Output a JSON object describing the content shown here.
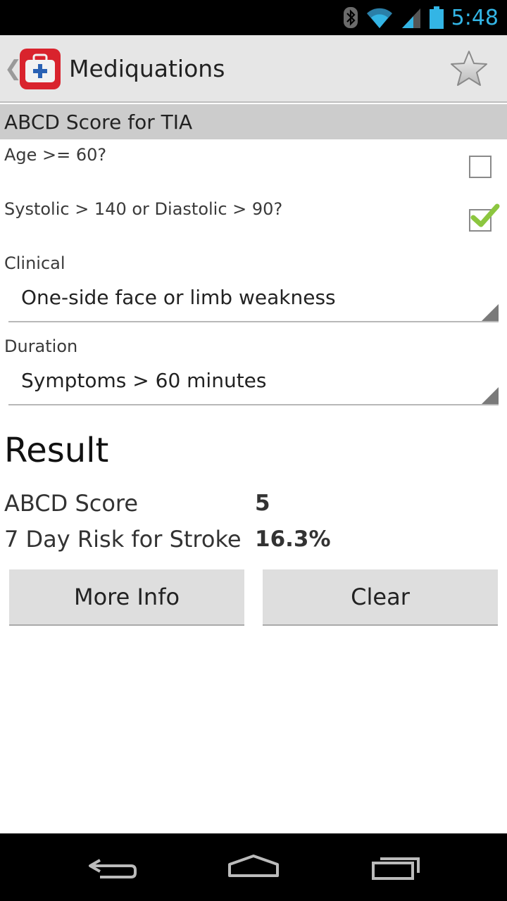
{
  "status_bar": {
    "time": "5:48",
    "icons": [
      "bluetooth-icon",
      "wifi-icon",
      "signal-icon",
      "battery-icon"
    ]
  },
  "action_bar": {
    "title": "Mediquations",
    "logo_icon": "medical-kit-icon",
    "favorite_icon": "star-icon"
  },
  "form": {
    "section_title": "ABCD Score for TIA",
    "age_label": "Age >= 60?",
    "age_checked": false,
    "bp_label": "Systolic > 140 or Diastolic > 90?",
    "bp_checked": true,
    "clinical_label": "Clinical",
    "clinical_value": "One-side face or limb weakness",
    "duration_label": "Duration",
    "duration_value": "Symptoms > 60 minutes"
  },
  "result": {
    "title": "Result",
    "score_label": "ABCD Score",
    "score_value": "5",
    "risk_label": "7 Day Risk for Stroke",
    "risk_value": "16.3%"
  },
  "buttons": {
    "more_info": "More Info",
    "clear": "Clear"
  },
  "nav_bar": {
    "icons": [
      "back-icon",
      "home-icon",
      "recent-apps-icon"
    ]
  },
  "colors": {
    "status_time": "#33b5e5",
    "action_bar_bg": "#e6e6e6",
    "section_header_bg": "#cccccc",
    "check_green": "#8cc63f",
    "logo_red": "#d9232d"
  }
}
